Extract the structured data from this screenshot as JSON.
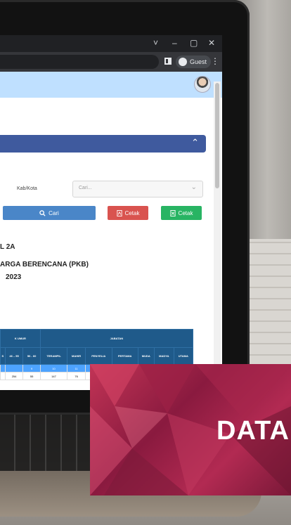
{
  "browser": {
    "window_controls": [
      "˅",
      "–",
      "▢",
      "✕"
    ],
    "profile_label": "Guest",
    "menu_glyph": "⋮"
  },
  "app": {
    "collapse_glyph": "⌃"
  },
  "filter": {
    "kab_label": "Kab/Kota",
    "select_placeholder": "Cari...",
    "select_arrow": "⌄"
  },
  "buttons": {
    "search_label": "Cari",
    "pdf_label": "Cetak",
    "excel_label": "Cetak"
  },
  "report": {
    "line1": "L 2A",
    "line2": "ARGA BERENCANA (PKB)",
    "line3": "2023"
  },
  "table": {
    "group_headers": [
      "K UMUR",
      "JABATAN"
    ],
    "sub_headers": [
      "S",
      "46 – 55",
      "56 - 60",
      "TERAMPIL",
      "MAHIR",
      "PENYELIA",
      "PERTAMA",
      "MUDA",
      "MADYA",
      "UTAMA"
    ],
    "blue_row": [
      "",
      "",
      "9",
      "10",
      "11",
      "12",
      "",
      "",
      "",
      ""
    ],
    "data_row": [
      "",
      "254",
      "55",
      "147",
      "76",
      "",
      "",
      "",
      "",
      ""
    ]
  },
  "banner": {
    "title": "DATA"
  },
  "colors": {
    "header_bg": "#bfe0ff",
    "collapse_bar": "#3f5a9e",
    "table_header": "#1f5a8a",
    "btn_search": "#4a86c8",
    "btn_pdf": "#d9534f",
    "btn_excel": "#28b463",
    "banner": "#b22a52"
  }
}
